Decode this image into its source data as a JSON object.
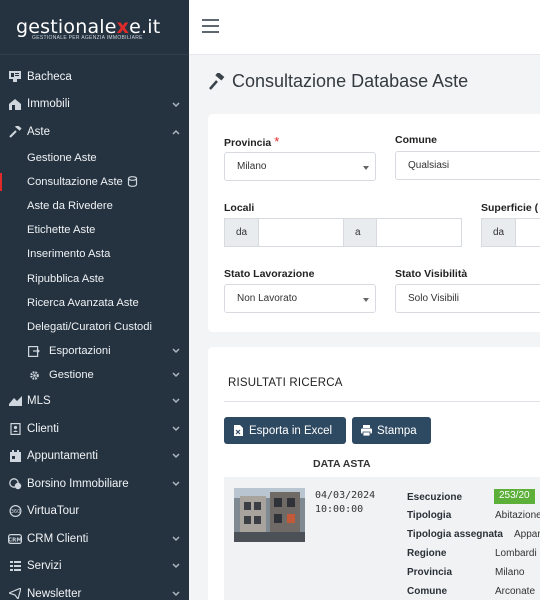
{
  "brand": {
    "name_a": "gestionale",
    "name_x": "x",
    "name_b": "e.it",
    "tagline": "GESTIONALE PER AGENZIA IMMOBILIARE"
  },
  "sidebar": {
    "items": [
      {
        "label": "Bacheca",
        "icon": "dashboard-icon",
        "chevron": false
      },
      {
        "label": "Immobili",
        "icon": "building-icon",
        "chevron": "down"
      },
      {
        "label": "Aste",
        "icon": "gavel-icon",
        "chevron": "up"
      }
    ],
    "aste_sub": [
      {
        "label": "Gestione Aste"
      },
      {
        "label": "Consultazione Aste"
      },
      {
        "label": "Aste da Rivedere"
      },
      {
        "label": "Etichette Aste"
      },
      {
        "label": "Inserimento Asta"
      },
      {
        "label": "Ripubblica Aste"
      },
      {
        "label": "Ricerca Avanzata Aste"
      },
      {
        "label": "Delegati/Curatori Custodi"
      },
      {
        "label": "Esportazioni"
      },
      {
        "label": "Gestione"
      }
    ],
    "items2": [
      {
        "label": "MLS",
        "icon": "mls-icon",
        "chevron": "down"
      },
      {
        "label": "Clienti",
        "icon": "address-book-icon",
        "chevron": "down"
      },
      {
        "label": "Appuntamenti",
        "icon": "calendar-icon",
        "chevron": "down"
      },
      {
        "label": "Borsino Immobiliare",
        "icon": "coins-icon",
        "chevron": "down"
      },
      {
        "label": "VirtuaTour",
        "icon": "360-icon",
        "chevron": false
      },
      {
        "label": "CRM Clienti",
        "icon": "crm-icon",
        "chevron": "down"
      },
      {
        "label": "Servizi",
        "icon": "grid-icon",
        "chevron": "down"
      },
      {
        "label": "Newsletter",
        "icon": "send-icon",
        "chevron": "down"
      }
    ]
  },
  "page": {
    "title": "Consultazione Database Aste"
  },
  "filters": {
    "provincia_label": "Provincia",
    "provincia_required": "*",
    "provincia_value": "Milano",
    "comune_label": "Comune",
    "comune_value": "Qualsiasi",
    "locali_label": "Locali",
    "locali_da": "da",
    "locali_a": "a",
    "superficie_label": "Superficie (",
    "superficie_da": "da",
    "stato_lav_label": "Stato Lavorazione",
    "stato_lav_value": "Non Lavorato",
    "stato_vis_label": "Stato Visibilità",
    "stato_vis_value": "Solo Visibili"
  },
  "results": {
    "title": "RISULTATI RICERCA",
    "export_label": "Esporta in Excel",
    "print_label": "Stampa",
    "col_data_asta": "DATA ASTA",
    "row": {
      "date": "04/03/2024",
      "time": "10:00:00",
      "fields": [
        {
          "k": "Esecuzione",
          "v": ""
        },
        {
          "k": "Tipologia",
          "v": "Abitazione"
        },
        {
          "k": "Tipologia assegnata",
          "v": "Appar"
        },
        {
          "k": "Regione",
          "v": "Lombardi"
        },
        {
          "k": "Provincia",
          "v": "Milano"
        },
        {
          "k": "Comune",
          "v": "Arconate"
        }
      ],
      "badge": "253/20"
    }
  },
  "colors": {
    "sidebar_bg": "#253341",
    "accent_red": "#e02b2b",
    "button_bg": "#2e4a63",
    "badge_green": "#5cb039"
  }
}
